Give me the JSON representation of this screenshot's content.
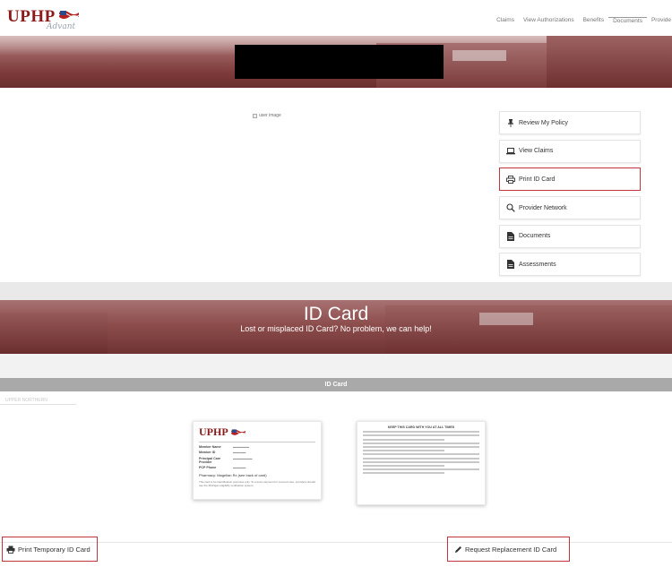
{
  "brand": {
    "logo_text": "UPHP",
    "logo_sub": "Advant"
  },
  "nav": {
    "items": [
      "Claims",
      "View Authorizations",
      "Benefits",
      "Documents",
      "Provide"
    ]
  },
  "portal": {
    "broken_image_alt": "user image",
    "menu": [
      {
        "label": "Review My Policy",
        "icon": "pin-icon"
      },
      {
        "label": "View Claims",
        "icon": "laptop-icon"
      },
      {
        "label": "Print ID Card",
        "icon": "printer-icon",
        "highlighted": true
      },
      {
        "label": "Provider Network",
        "icon": "search-icon"
      },
      {
        "label": "Documents",
        "icon": "document-icon"
      },
      {
        "label": "Assessments",
        "icon": "document-icon"
      }
    ]
  },
  "id_page": {
    "title": "ID Card",
    "subtitle": "Lost or misplaced ID Card? No problem, we can help!",
    "section_header": "ID Card",
    "faint_tab": "UPPER NORTHERN",
    "card_front": {
      "logo": "UPHP",
      "member_name_label": "Member Name",
      "member_id_label": "Member ID",
      "pcp_label": "Principal Care Provider",
      "pcp_phone_label": "PCP Phone",
      "pharmacy": "Pharmacy:   Magellan Rx (see back of card)",
      "note": "This card is for identification purposes only. To ensure payment for covered care, providers should use the Michigan eligibility verification system."
    },
    "card_back": {
      "title": "KEEP THIS CARD WITH YOU AT ALL TIMES"
    },
    "print_button": "Print Temporary ID Card",
    "replace_button": "Request Replacement ID Card"
  },
  "colors": {
    "brand_red": "#8b1a1a",
    "highlight": "#c0353a",
    "section_bar": "#a9a9a9"
  }
}
